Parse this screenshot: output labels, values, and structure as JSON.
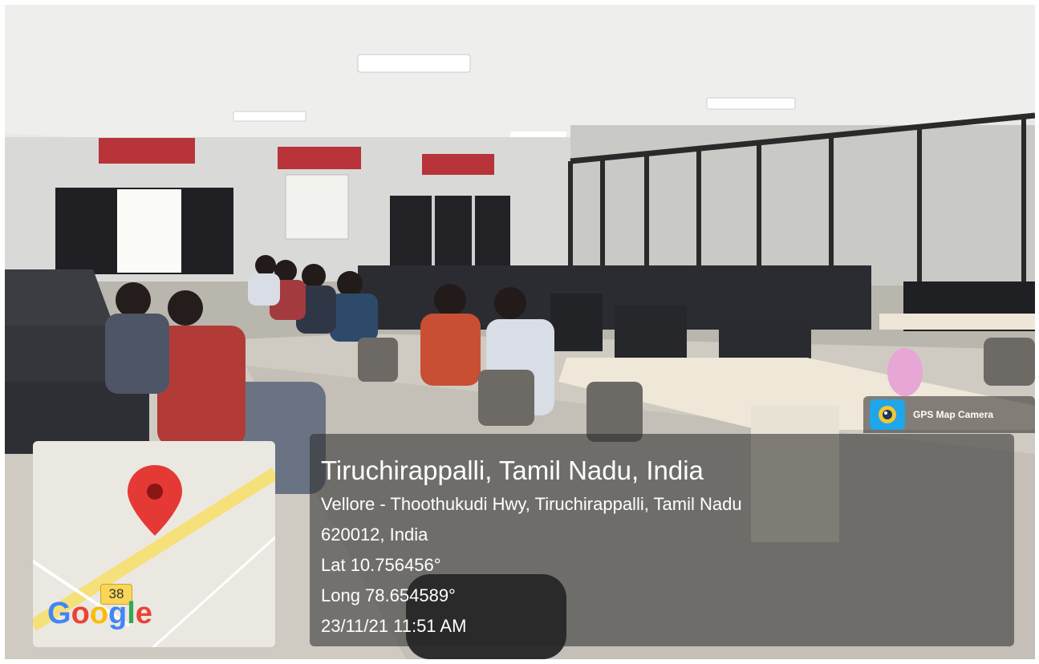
{
  "photo": {
    "description_icon": "classroom-photo"
  },
  "map": {
    "pin_icon": "map-pin-icon",
    "road_number": "38",
    "logo_text": "Google",
    "logo_colors": [
      "#4285F4",
      "#EA4335",
      "#FBBC05",
      "#4285F4",
      "#34A853",
      "#EA4335"
    ]
  },
  "badge": {
    "icon": "camera-lens-icon",
    "label": "GPS Map Camera"
  },
  "location": {
    "title": "Tiruchirappalli, Tamil Nadu, India",
    "address_line1": "Vellore - Thoothukudi Hwy, Tiruchirappalli, Tamil Nadu",
    "address_line2": "620012, India",
    "latitude": "Lat 10.756456°",
    "longitude": "Long 78.654589°",
    "datetime": "23/11/21 11:51 AM"
  },
  "colors": {
    "pin": "#e53935",
    "overlay": "#282828"
  }
}
